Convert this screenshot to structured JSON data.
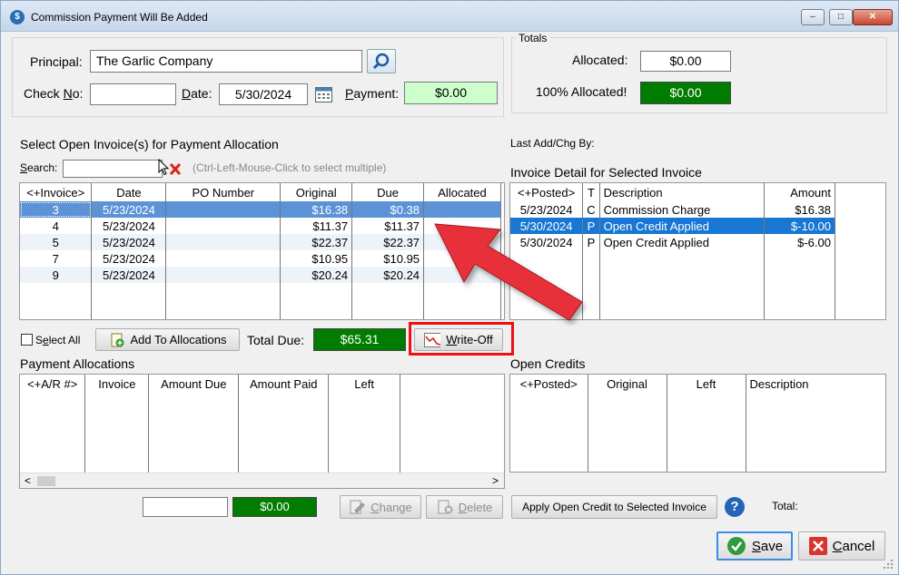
{
  "window": {
    "title": "Commission Payment Will Be Added",
    "controls": [
      "–",
      "□",
      "✕"
    ]
  },
  "header": {
    "principal_label": "Principal:",
    "principal_value": "The Garlic Company",
    "checkno_label_pre": "Check ",
    "checkno_label_u": "N",
    "checkno_label_post": "o:",
    "checkno_value": "",
    "date_label_pre": "D",
    "date_label_post": "ate:",
    "date_value": "5/30/2024",
    "payment_label_pre": "",
    "payment_label_u": "P",
    "payment_label_post": "ayment:",
    "payment_value": "$0.00"
  },
  "totals": {
    "legend": "Totals",
    "allocated_label": "Allocated:",
    "allocated_value": "$0.00",
    "full_label": "100% Allocated!",
    "full_value": "$0.00"
  },
  "invoices": {
    "title": "Select Open Invoice(s) for Payment Allocation",
    "search_label_u": "S",
    "search_label_post": "earch:",
    "search_value": "",
    "hint": "(Ctrl-Left-Mouse-Click to select multiple)",
    "columns": [
      "<+Invoice>",
      "Date",
      "PO Number",
      "Original",
      "Due",
      "Allocated"
    ],
    "rows": [
      {
        "invoice": "3",
        "date": "5/23/2024",
        "po": "",
        "original": "$16.38",
        "due": "$0.38",
        "allocated": ""
      },
      {
        "invoice": "4",
        "date": "5/23/2024",
        "po": "",
        "original": "$11.37",
        "due": "$11.37",
        "allocated": ""
      },
      {
        "invoice": "5",
        "date": "5/23/2024",
        "po": "",
        "original": "$22.37",
        "due": "$22.37",
        "allocated": ""
      },
      {
        "invoice": "7",
        "date": "5/23/2024",
        "po": "",
        "original": "$10.95",
        "due": "$10.95",
        "allocated": ""
      },
      {
        "invoice": "9",
        "date": "5/23/2024",
        "po": "",
        "original": "$20.24",
        "due": "$20.24",
        "allocated": ""
      }
    ],
    "select_all_pre": "S",
    "select_all_u": "e",
    "select_all_post": "lect All",
    "add_button": "Add To Allocations",
    "add_button_u": "A",
    "total_due_label": "Total Due:",
    "total_due_value": "$65.31",
    "writeoff_button_u": "W",
    "writeoff_button_post": "rite-Off"
  },
  "detail": {
    "last_add_label": "Last Add/Chg By:",
    "title": "Invoice Detail for Selected Invoice",
    "columns": [
      "<+Posted>",
      "T",
      "Description",
      "Amount"
    ],
    "rows": [
      {
        "posted": "5/23/2024",
        "t": "C",
        "description": "Commission Charge",
        "amount": "$16.38"
      },
      {
        "posted": "5/30/2024",
        "t": "P",
        "description": "Open Credit Applied",
        "amount": "$-10.00"
      },
      {
        "posted": "5/30/2024",
        "t": "P",
        "description": "Open Credit Applied",
        "amount": "$-6.00"
      }
    ]
  },
  "allocations": {
    "title": "Payment Allocations",
    "columns": [
      "<+A/R #>",
      "Invoice",
      "Amount Due",
      "Amount Paid",
      "Left"
    ],
    "scroll_left": "<",
    "scroll_right": ">",
    "edit_value": "",
    "edit_amount": "$0.00",
    "change_u": "C",
    "change_post": "hange",
    "delete_u": "D",
    "delete_post": "elete"
  },
  "credits": {
    "title": "Open Credits",
    "columns": [
      "<+Posted>",
      "Original",
      "Left",
      "Description"
    ],
    "apply_button": "Apply Open Credit to Selected Invoice",
    "help": "?",
    "total_label": "Total:"
  },
  "footer": {
    "save_u": "S",
    "save_post": "ave",
    "cancel_u": "C",
    "cancel_post": "ancel"
  },
  "colors": {
    "selection": "#1777d3",
    "money_green": "#007d00",
    "annotation_red": "#e11"
  }
}
